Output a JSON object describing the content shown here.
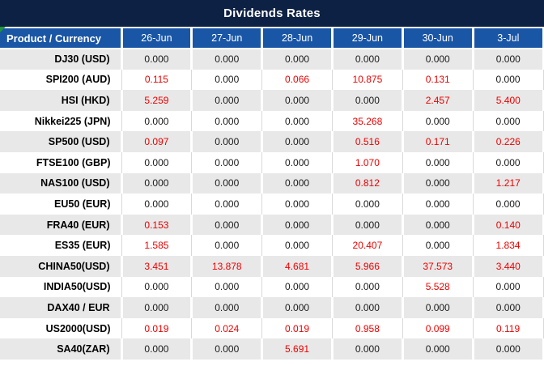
{
  "title": "Dividends Rates",
  "table": {
    "product_header": "Product / Currency",
    "date_headers": [
      "26-Jun",
      "27-Jun",
      "28-Jun",
      "29-Jun",
      "30-Jun",
      "3-Jul"
    ],
    "rows": [
      {
        "product": "DJ30 (USD)",
        "values": [
          "0.000",
          "0.000",
          "0.000",
          "0.000",
          "0.000",
          "0.000"
        ]
      },
      {
        "product": "SPI200 (AUD)",
        "values": [
          "0.115",
          "0.000",
          "0.066",
          "10.875",
          "0.131",
          "0.000"
        ]
      },
      {
        "product": "HSI (HKD)",
        "values": [
          "5.259",
          "0.000",
          "0.000",
          "0.000",
          "2.457",
          "5.400"
        ]
      },
      {
        "product": "Nikkei225 (JPN)",
        "values": [
          "0.000",
          "0.000",
          "0.000",
          "35.268",
          "0.000",
          "0.000"
        ]
      },
      {
        "product": "SP500 (USD)",
        "values": [
          "0.097",
          "0.000",
          "0.000",
          "0.516",
          "0.171",
          "0.226"
        ]
      },
      {
        "product": "FTSE100 (GBP)",
        "values": [
          "0.000",
          "0.000",
          "0.000",
          "1.070",
          "0.000",
          "0.000"
        ]
      },
      {
        "product": "NAS100 (USD)",
        "values": [
          "0.000",
          "0.000",
          "0.000",
          "0.812",
          "0.000",
          "1.217"
        ]
      },
      {
        "product": "EU50 (EUR)",
        "values": [
          "0.000",
          "0.000",
          "0.000",
          "0.000",
          "0.000",
          "0.000"
        ]
      },
      {
        "product": "FRA40 (EUR)",
        "values": [
          "0.153",
          "0.000",
          "0.000",
          "0.000",
          "0.000",
          "0.140"
        ]
      },
      {
        "product": "ES35 (EUR)",
        "values": [
          "1.585",
          "0.000",
          "0.000",
          "20.407",
          "0.000",
          "1.834"
        ]
      },
      {
        "product": "CHINA50(USD)",
        "values": [
          "3.451",
          "13.878",
          "4.681",
          "5.966",
          "37.573",
          "3.440"
        ]
      },
      {
        "product": "INDIA50(USD)",
        "values": [
          "0.000",
          "0.000",
          "0.000",
          "0.000",
          "5.528",
          "0.000"
        ]
      },
      {
        "product": "DAX40 / EUR",
        "values": [
          "0.000",
          "0.000",
          "0.000",
          "0.000",
          "0.000",
          "0.000"
        ]
      },
      {
        "product": "US2000(USD)",
        "values": [
          "0.019",
          "0.024",
          "0.019",
          "0.958",
          "0.099",
          "0.119"
        ]
      },
      {
        "product": "SA40(ZAR)",
        "values": [
          "0.000",
          "0.000",
          "5.691",
          "0.000",
          "0.000",
          "0.000"
        ]
      }
    ]
  },
  "colors": {
    "title_bg": "#0d2144",
    "header_bg": "#1a56a6",
    "stripe_bg": "#e8e8e8",
    "row_bg": "#ffffff",
    "zero_color": "#1a1a1a",
    "nonzero_color": "#ee0000",
    "product_color": "#000000",
    "header_text": "#ffffff",
    "grid_white": "#ffffff",
    "grid_gray": "#d9d9d9",
    "triangle_green": "#1e9638"
  },
  "icons": {
    "corner_indicator": "excel-green-corner-triangle"
  }
}
